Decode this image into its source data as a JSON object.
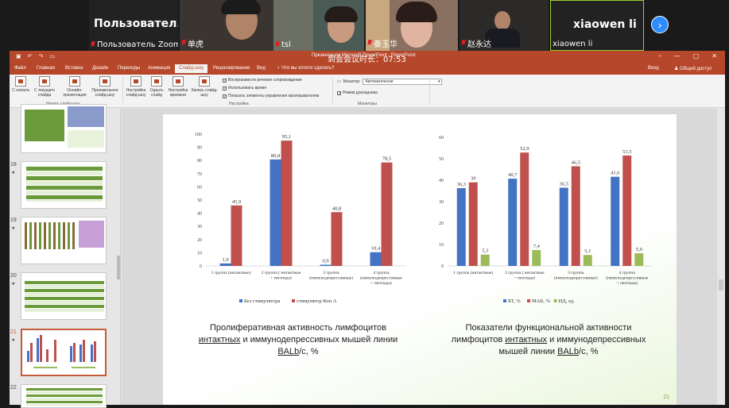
{
  "zoom": {
    "participants": [
      {
        "name": "Пользователь Zoom",
        "display": "Пользовател...",
        "muted": true
      },
      {
        "name": "单虎",
        "muted": true
      },
      {
        "name": "tsl",
        "muted": true
      },
      {
        "name": "秦玉华",
        "muted": true
      },
      {
        "name": "赵永达",
        "muted": true
      },
      {
        "name": "xiaowen li",
        "display": "xiaowen li",
        "muted": false
      }
    ],
    "next_icon": "chevron-right-icon"
  },
  "ppt": {
    "window_title": "Презентация Microsoft PowerPoint - PowerPoint",
    "meeting_time": "到会会议时长：07:53",
    "tabs": [
      "Файл",
      "Главная",
      "Вставка",
      "Дизайн",
      "Переходы",
      "Анимация",
      "Слайд-шоу",
      "Рецензирование",
      "Вид"
    ],
    "active_tab": "Слайд-шоу",
    "tell_me": "Что вы хотите сделать?",
    "sign_in": "Вход",
    "share": "Общий доступ",
    "ribbon": {
      "buttons": [
        {
          "label": "С начала"
        },
        {
          "label": "С текущего слайда"
        },
        {
          "label": "Онлайн-презентация"
        },
        {
          "label": "Произвольное слайд-шоу"
        },
        {
          "label": "Настройка слайд-шоу"
        },
        {
          "label": "Скрыть слайд"
        },
        {
          "label": "Настройка времени"
        },
        {
          "label": "Запись слайд-шоу"
        }
      ],
      "group_start": "Начать слайд-шоу",
      "group_setup": "Настройка",
      "group_monitors": "Мониторы",
      "checks": [
        {
          "label": "Воспроизвести речевое сопровождение",
          "checked": true
        },
        {
          "label": "Использовать время",
          "checked": true
        },
        {
          "label": "Показать элементы управления проигрывателем",
          "checked": true
        }
      ],
      "monitor_label": "Монитор:",
      "monitor_value": "Автоматически",
      "presenter_view": "Режим докладчика"
    },
    "thumbnails": [
      {
        "num": "",
        "star": "",
        "top_offset": -12
      },
      {
        "num": "18",
        "star": "★"
      },
      {
        "num": "19",
        "star": "★"
      },
      {
        "num": "20",
        "star": "★"
      },
      {
        "num": "21",
        "star": "★",
        "selected": true
      },
      {
        "num": "22",
        "star": ""
      }
    ],
    "slide_number": "21"
  },
  "slide": {
    "left_caption_line1": "Пролиферативная активность лимфоцитов",
    "left_caption_line2a": "интактных",
    "left_caption_line2b": " и иммунодепрессивных мышей линии",
    "left_caption_line3a": "BALb",
    "left_caption_line3b": "/с, %",
    "right_caption_line1": "Показатели функциональной активности",
    "right_caption_line2a": "лимфоцитов ",
    "right_caption_line2b": "интактных",
    "right_caption_line2c": " и иммунодепрессивных",
    "right_caption_line3a": "мышей линии ",
    "right_caption_line3b": "BALb",
    "right_caption_line3c": "/с, %"
  },
  "chart_data": [
    {
      "type": "bar",
      "categories": [
        "1 группа  (интактные)",
        "2 группа ( интактные + пептиды)",
        "3 группа (иммунодепрессивные)",
        "4 группа (иммунодепрессивные + пептиды)"
      ],
      "series": [
        {
          "name": "Без стимулятора",
          "values": [
            1.9,
            80.8,
            0.9,
            10.4
          ],
          "labels": [
            "1,9",
            "80,8",
            "0,9",
            "10,4"
          ],
          "color": "#4472c4"
        },
        {
          "name": "стимулятор Кон А",
          "values": [
            45.9,
            95.1,
            40.8,
            78.5
          ],
          "labels": [
            "45,9",
            "95,1",
            "40,8",
            "78,5"
          ],
          "color": "#c0504d"
        }
      ],
      "ylim": [
        0,
        100
      ],
      "yticks": [
        "0",
        "10",
        "20",
        "30",
        "40",
        "50",
        "60",
        "70",
        "80",
        "90",
        "100"
      ],
      "legend_position": "bottom",
      "xlabel": "",
      "ylabel": ""
    },
    {
      "type": "bar",
      "categories": [
        "1 группа  (интактные)",
        "2 группа ( интактные + пептиды)",
        "3 группа (иммунодепрессивные)",
        "4 группа (иммунодепрессивные + пептиды)"
      ],
      "series": [
        {
          "name": "БТ, %",
          "values": [
            36.3,
            40.7,
            36.5,
            41.6
          ],
          "labels": [
            "36,3",
            "40,7",
            "36,5",
            "41,6"
          ],
          "color": "#4472c4"
        },
        {
          "name": "МАБ, %",
          "values": [
            39,
            52.9,
            46.5,
            51.5
          ],
          "labels": [
            "39",
            "52,9",
            "46,5",
            "51,5"
          ],
          "color": "#c0504d"
        },
        {
          "name": "ИД, ед.",
          "values": [
            5.3,
            7.4,
            5.1,
            5.9
          ],
          "labels": [
            "5,3",
            "7,4",
            "5,1",
            "5,9"
          ],
          "color": "#9bbb59"
        }
      ],
      "ylim": [
        0,
        60
      ],
      "yticks": [
        "0",
        "10",
        "20",
        "30",
        "40",
        "50",
        "60"
      ],
      "legend_position": "bottom",
      "xlabel": "",
      "ylabel": ""
    }
  ]
}
